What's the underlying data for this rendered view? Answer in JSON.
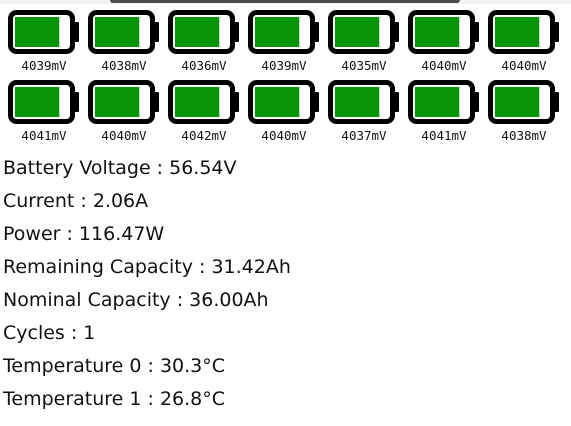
{
  "cells": {
    "row1": [
      {
        "voltage": "4039mV",
        "fill_color": "#079407",
        "charge_fraction": 0.82
      },
      {
        "voltage": "4038mV",
        "fill_color": "#079407",
        "charge_fraction": 0.82
      },
      {
        "voltage": "4036mV",
        "fill_color": "#079407",
        "charge_fraction": 0.82
      },
      {
        "voltage": "4039mV",
        "fill_color": "#079407",
        "charge_fraction": 0.82
      },
      {
        "voltage": "4035mV",
        "fill_color": "#079407",
        "charge_fraction": 0.82
      },
      {
        "voltage": "4040mV",
        "fill_color": "#079407",
        "charge_fraction": 0.82
      },
      {
        "voltage": "4040mV",
        "fill_color": "#079407",
        "charge_fraction": 0.82
      }
    ],
    "row2": [
      {
        "voltage": "4041mV",
        "fill_color": "#079407",
        "charge_fraction": 0.82
      },
      {
        "voltage": "4040mV",
        "fill_color": "#079407",
        "charge_fraction": 0.82
      },
      {
        "voltage": "4042mV",
        "fill_color": "#079407",
        "charge_fraction": 0.82
      },
      {
        "voltage": "4040mV",
        "fill_color": "#079407",
        "charge_fraction": 0.82
      },
      {
        "voltage": "4037mV",
        "fill_color": "#079407",
        "charge_fraction": 0.82
      },
      {
        "voltage": "4041mV",
        "fill_color": "#079407",
        "charge_fraction": 0.82
      },
      {
        "voltage": "4038mV",
        "fill_color": "#079407",
        "charge_fraction": 0.82
      }
    ]
  },
  "info": {
    "battery_voltage": "Battery Voltage : 56.54V",
    "current": "Current : 2.06A",
    "power": "Power : 116.47W",
    "remaining_capacity": "Remaining Capacity : 31.42Ah",
    "nominal_capacity": "Nominal Capacity : 36.00Ah",
    "cycles": "Cycles : 1",
    "temperature_0": "Temperature 0 : 30.3°C",
    "temperature_1": "Temperature 1 : 26.8°C"
  },
  "colors": {
    "battery_outline": "#000000",
    "battery_fill": "#079407",
    "text": "#111111"
  }
}
